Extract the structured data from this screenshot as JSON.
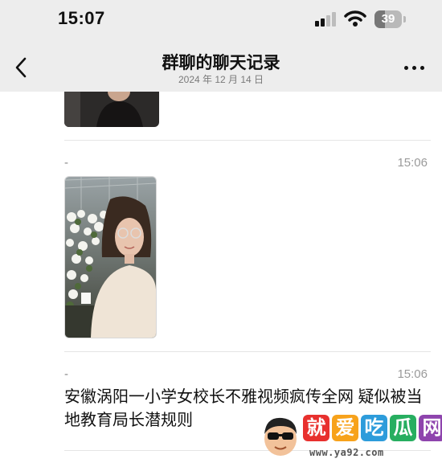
{
  "status_bar": {
    "time": "15:07",
    "battery_level": "39",
    "battery_fraction": 0.39
  },
  "nav": {
    "title": "群聊的聊天记录",
    "subtitle": "2024 年 12 月 14 日"
  },
  "messages": [
    {
      "sender": "-",
      "time": "15:06",
      "type": "image"
    },
    {
      "sender": "-",
      "time": "15:06",
      "type": "text",
      "text": "安徽涡阳一小学女校长不雅视频疯传全网 疑似被当地教育局长潜规则"
    }
  ],
  "watermark": {
    "chars": [
      "就",
      "爱",
      "吃",
      "瓜",
      "网"
    ],
    "url": "www.ya92.com",
    "colors": [
      "#e8302e",
      "#f7a21b",
      "#2d9cdb",
      "#27ae60",
      "#8e44ad"
    ]
  },
  "colors": {
    "header_bg": "#ededed",
    "content_bg": "#ffffff",
    "secondary_text": "#888888"
  }
}
